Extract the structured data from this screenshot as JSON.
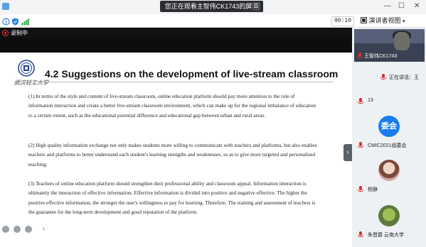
{
  "share_banner": {
    "text": "您正在观看主智伟CK1743的屏幕",
    "menu_icon": "menu-icon"
  },
  "toolbar": {
    "timer": "00:10",
    "speaker_view": "演讲者视图"
  },
  "recording": {
    "label": "录制中"
  },
  "slide": {
    "title": "4.2 Suggestions on the development of live-stream classroom",
    "logo_script": "武汉轻工大学",
    "paragraphs": [
      "(1) In terms of the style and content of live-stream classroom, online education platform should pay more attention to the role of information interaction and create a better live-stream classroom environment, which can make up for the regional imbalance of education to a certain extent, such as the educational potential difference and educational gap between urban and rural areas.",
      "(2) High quality information exchange not only makes students more willing to communicate with teachers and platforms, but also enables teachers and platforms to better understand each student's learning strengths and weaknesses, so as to give more targeted and personalized teaching.",
      "(3) Teachers of online education platform should strengthen their professional ability and classroom appeal. Information interaction is ultimately the interaction of effective information. Effective information is divided into positive and negative effective. The higher the positive effective information, the stronger the user's willingness to pay for learning. Therefore, The training and assessment of teachers is the guarantee for the long-term development and good reputation of the platform."
    ]
  },
  "participants": [
    {
      "name": "王智伟CK1743",
      "kind": "video"
    },
    {
      "name": "正在讲话：王",
      "kind": "speaking"
    },
    {
      "name": "13",
      "kind": "plain"
    },
    {
      "name": "CMIC2021组委会",
      "kind": "avatar",
      "avatar_text": "委会",
      "avatar_color": "#1a7cf0"
    },
    {
      "name": "杨静",
      "kind": "photo",
      "avatar_color": "#c9a7a0"
    },
    {
      "name": "朱晋爵 云南大学",
      "kind": "photo",
      "avatar_color": "#5e7a3a"
    }
  ]
}
